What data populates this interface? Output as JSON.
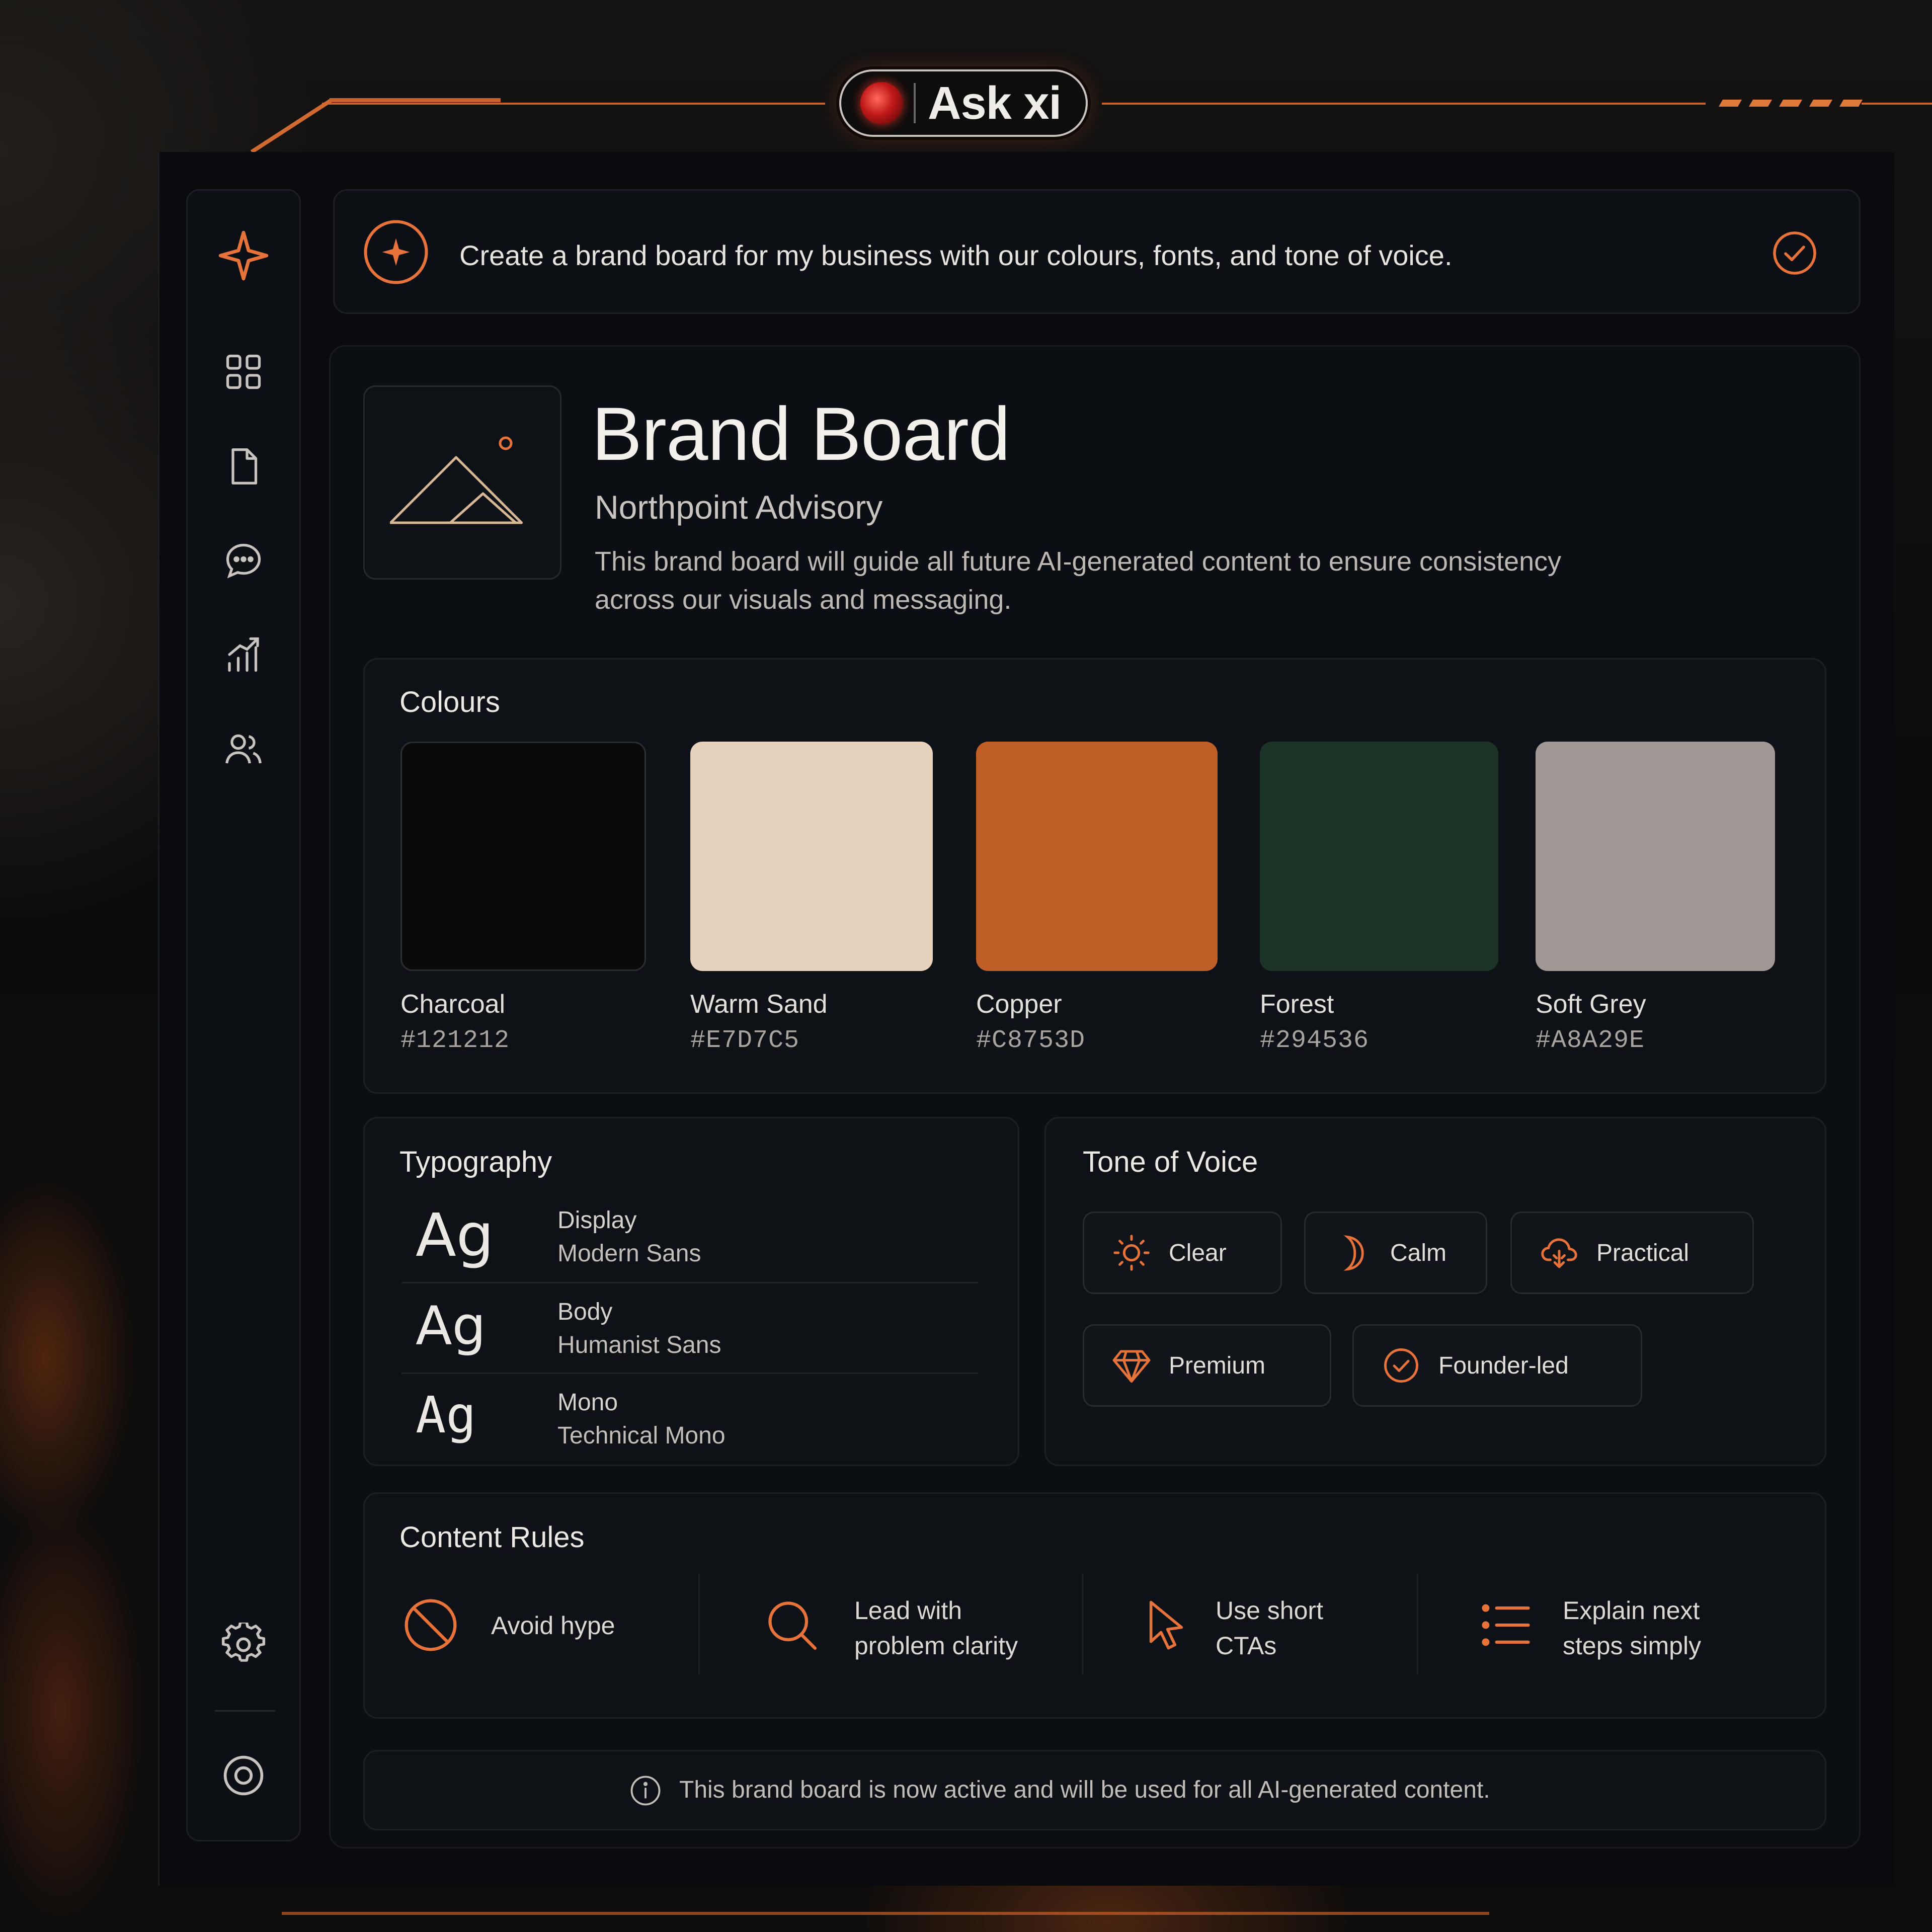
{
  "app": {
    "name": "Ask xi"
  },
  "prompt": {
    "text": "Create a brand board for my business with our colours, fonts, and tone of voice."
  },
  "sidebar": {
    "items": [
      {
        "icon": "sparkle-icon"
      },
      {
        "icon": "grid-icon"
      },
      {
        "icon": "document-icon"
      },
      {
        "icon": "chat-icon"
      },
      {
        "icon": "analytics-icon"
      },
      {
        "icon": "users-icon"
      },
      {
        "icon": "gear-icon"
      },
      {
        "icon": "target-icon"
      }
    ]
  },
  "board": {
    "title": "Brand Board",
    "company": "Northpoint Advisory",
    "description": "This brand board will guide all future AI-generated content to ensure consistency across our visuals and messaging."
  },
  "colours": {
    "heading": "Colours",
    "swatches": [
      {
        "name": "Charcoal",
        "hex": "#121212"
      },
      {
        "name": "Warm Sand",
        "hex": "#E7D7C5"
      },
      {
        "name": "Copper",
        "hex": "#C8753D"
      },
      {
        "name": "Forest",
        "hex": "#294536"
      },
      {
        "name": "Soft Grey",
        "hex": "#A8A29E"
      }
    ]
  },
  "typography": {
    "heading": "Typography",
    "rows": [
      {
        "sample": "Ag",
        "role": "Display",
        "face": "Modern Sans"
      },
      {
        "sample": "Ag",
        "role": "Body",
        "face": "Humanist Sans"
      },
      {
        "sample": "Ag",
        "role": "Mono",
        "face": "Technical Mono"
      }
    ]
  },
  "tone": {
    "heading": "Tone of Voice",
    "chips": [
      {
        "label": "Clear",
        "icon": "sun-icon"
      },
      {
        "label": "Calm",
        "icon": "moon-icon"
      },
      {
        "label": "Practical",
        "icon": "cloud-icon"
      },
      {
        "label": "Premium",
        "icon": "diamond-icon"
      },
      {
        "label": "Founder-led",
        "icon": "check-circle-icon"
      }
    ]
  },
  "rules": {
    "heading": "Content Rules",
    "items": [
      {
        "line1": "Avoid hype",
        "line2": "",
        "icon": "no-entry-icon"
      },
      {
        "line1": "Lead with",
        "line2": "problem clarity",
        "icon": "search-icon"
      },
      {
        "line1": "Use short",
        "line2": "CTAs",
        "icon": "cursor-icon"
      },
      {
        "line1": "Explain next",
        "line2": "steps simply",
        "icon": "list-icon"
      }
    ]
  },
  "footer": {
    "text": "This brand board is now active and will be used for all AI-generated content."
  },
  "accent": "#E8733A"
}
